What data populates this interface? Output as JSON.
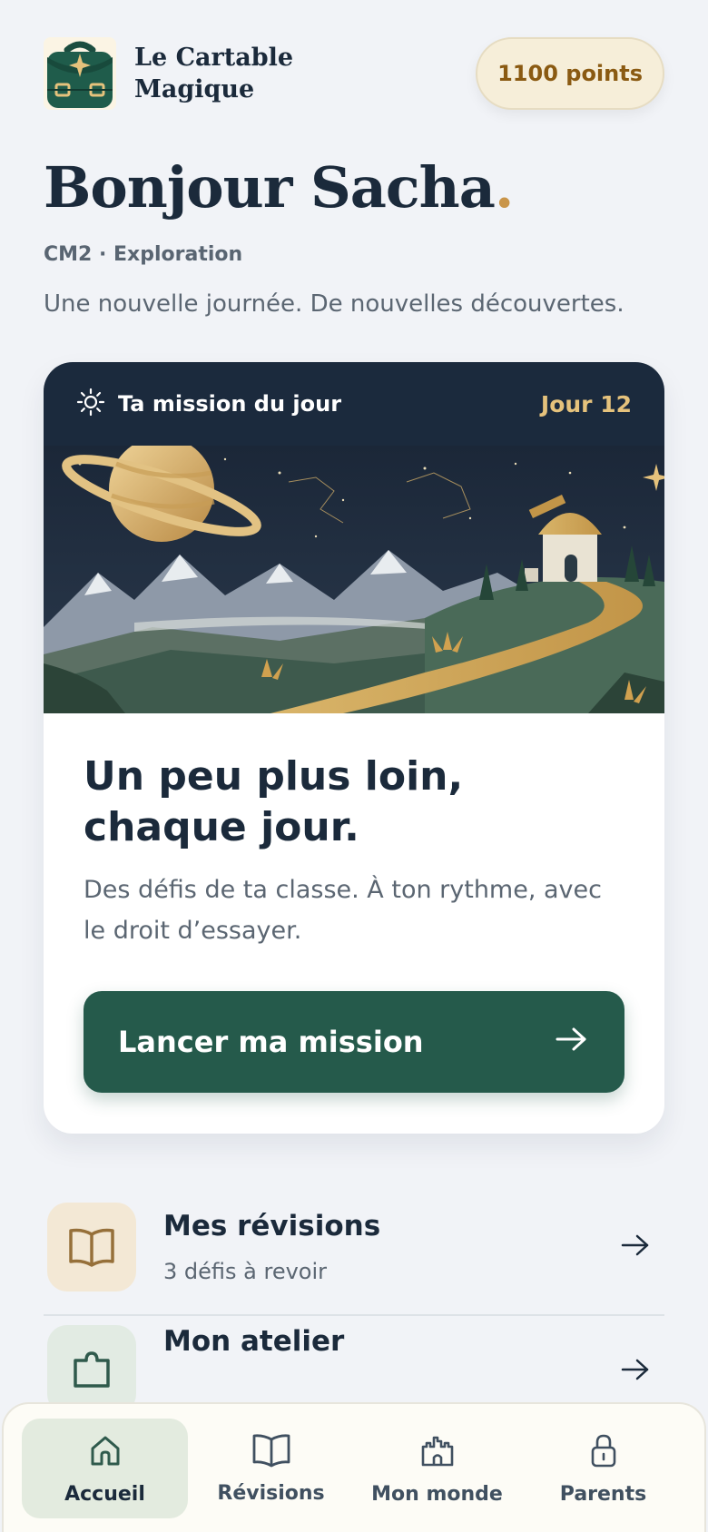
{
  "header": {
    "app_name": "Le Cartable Magique",
    "points": "1100 points",
    "logo_icon": "satchel-star-icon"
  },
  "greeting": {
    "text": "Bonjour Sacha",
    "accent_dot": ".",
    "level": "CM2 · Exploration",
    "tagline": "Une nouvelle journée. De nouvelles découvertes."
  },
  "mission": {
    "label": "Ta mission du jour",
    "day": "Jour 12",
    "headline": "Un peu plus loin, chaque jour.",
    "description": "Des défis de ta classe. À ton rythme, avec le droit d’essayer.",
    "cta_label": "Lancer ma mission",
    "icon": "sun-icon",
    "illustration": "saturn-observatory-landscape"
  },
  "list": [
    {
      "title": "Mes révisions",
      "subtitle": "3 défis à revoir",
      "icon": "book-icon"
    },
    {
      "title": "Mon atelier",
      "subtitle": "",
      "icon": "puzzle-icon"
    }
  ],
  "tabs": [
    {
      "label": "Accueil",
      "icon": "home-icon",
      "active": true
    },
    {
      "label": "Révisions",
      "icon": "book-icon",
      "active": false
    },
    {
      "label": "Mon monde",
      "icon": "castle-icon",
      "active": false
    },
    {
      "label": "Parents",
      "icon": "lock-icon",
      "active": false
    }
  ],
  "colors": {
    "background": "#f1f3f7",
    "navy": "#1b2a3b",
    "primary_green": "#255a4b",
    "gold": "#c9954a",
    "points_bg": "#f6eed9"
  }
}
